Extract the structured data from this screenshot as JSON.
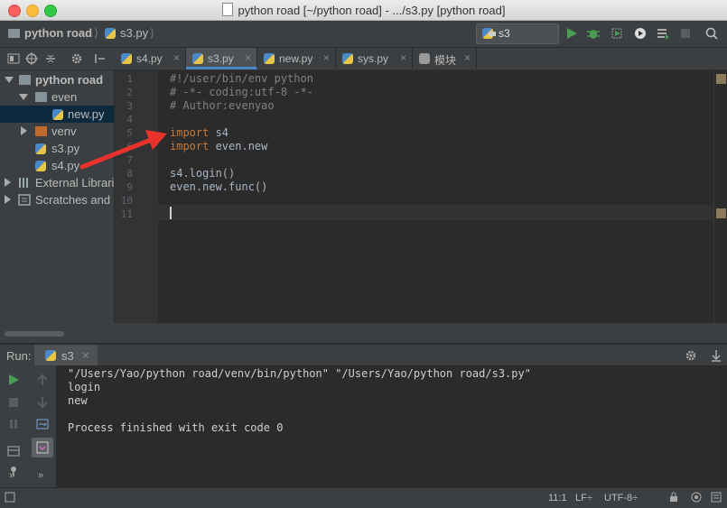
{
  "window": {
    "title": "python road [~/python road] - .../s3.py [python road]"
  },
  "navbar": {
    "project": "python road",
    "file": "s3.py",
    "sep": "⟩",
    "run_config": "s3"
  },
  "tabs": [
    {
      "label": "s4.py",
      "active": false
    },
    {
      "label": "s3.py",
      "active": true
    },
    {
      "label": "new.py",
      "active": false
    },
    {
      "label": "sys.py",
      "active": false
    },
    {
      "label": "模块",
      "active": false
    }
  ],
  "tree": {
    "root": "python road",
    "even": "even",
    "new": "new.py",
    "venv": "venv",
    "s3": "s3.py",
    "s4": "s4.py",
    "external": "External Libraries",
    "scratches": "Scratches and Consoles"
  },
  "editor": {
    "line_numbers": [
      "1",
      "2",
      "3",
      "4",
      "5",
      "6",
      "7",
      "8",
      "9",
      "10",
      "11"
    ],
    "lines": [
      "#!/user/bin/env python",
      "# -*- coding:utf-8 -*-",
      "# Author:evenyao",
      "",
      "import s4",
      "import even.new",
      "",
      "s4.login()",
      "even.new.func()",
      "",
      ""
    ],
    "kw_import": "import",
    "mod1": " s4",
    "mod2": " even.new"
  },
  "run": {
    "label": "Run:",
    "tab": "s3",
    "output": [
      "\"/Users/Yao/python road/venv/bin/python\" \"/Users/Yao/python road/s3.py\"",
      "login",
      "new",
      "",
      "Process finished with exit code 0"
    ]
  },
  "status": {
    "position": "11:1",
    "line_sep": "LF÷",
    "encoding": "UTF-8÷"
  },
  "colors": {
    "accent": "#4a88c7",
    "keyword": "#cc7832",
    "comment": "#808080",
    "arrow": "#e8322c"
  }
}
